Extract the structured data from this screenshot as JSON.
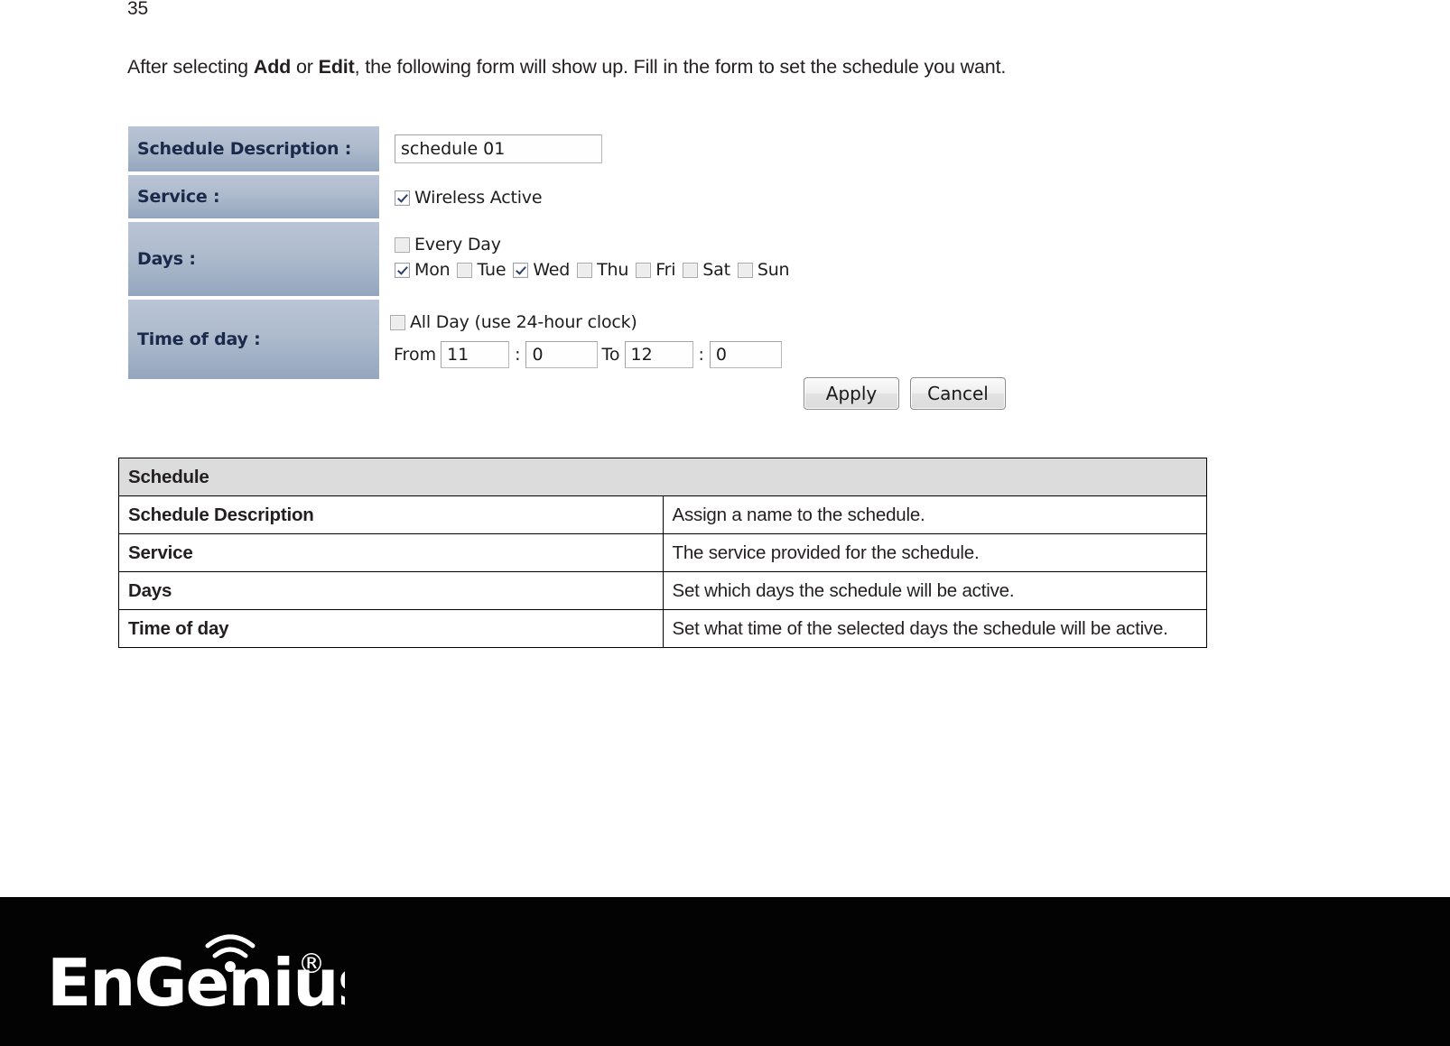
{
  "page": {
    "number": "35"
  },
  "intro": {
    "prefix": "After selecting ",
    "bold1": "Add",
    "middle": " or ",
    "bold2": "Edit",
    "suffix": ", the following form will show up. Fill in the form to set the schedule you want."
  },
  "form": {
    "rows": {
      "description": {
        "label": "Schedule Description :",
        "value": "schedule 01"
      },
      "service": {
        "label": "Service :",
        "checkbox_label": "Wireless Active",
        "checked": true
      },
      "days": {
        "label": "Days :",
        "every_day_label": "Every Day",
        "every_day_checked": false,
        "items": [
          {
            "label": "Mon",
            "checked": true
          },
          {
            "label": "Tue",
            "checked": false
          },
          {
            "label": "Wed",
            "checked": true
          },
          {
            "label": "Thu",
            "checked": false
          },
          {
            "label": "Fri",
            "checked": false
          },
          {
            "label": "Sat",
            "checked": false
          },
          {
            "label": "Sun",
            "checked": false
          }
        ]
      },
      "time": {
        "label": "Time of day :",
        "all_day_label": "All Day (use 24-hour clock)",
        "all_day_checked": false,
        "from_word": "From",
        "from_hour": "11",
        "colon1": ":",
        "from_minute": "0",
        "to_word": "To",
        "to_hour": "12",
        "colon2": ":",
        "to_minute": "0"
      }
    },
    "buttons": {
      "apply": "Apply",
      "cancel": "Cancel"
    }
  },
  "description_table": {
    "header": "Schedule",
    "rows": [
      {
        "term": "Schedule Description",
        "definition": "Assign a name to the schedule."
      },
      {
        "term": "Service",
        "definition": "The service provided for the schedule."
      },
      {
        "term": "Days",
        "definition": "Set which days the schedule will be active."
      },
      {
        "term": "Time of day",
        "definition": "Set what time of the selected days the schedule will be active."
      }
    ]
  },
  "footer": {
    "brand": "EnGenius",
    "trademark": "®",
    "background_color": "#030303",
    "logo_color": "#ffffff"
  },
  "colors": {
    "form_label_bg": "#aebbcd",
    "form_label_text": "#1b2a4a",
    "table_header_bg": "#dcdcdc",
    "body_text": "#231f20"
  }
}
